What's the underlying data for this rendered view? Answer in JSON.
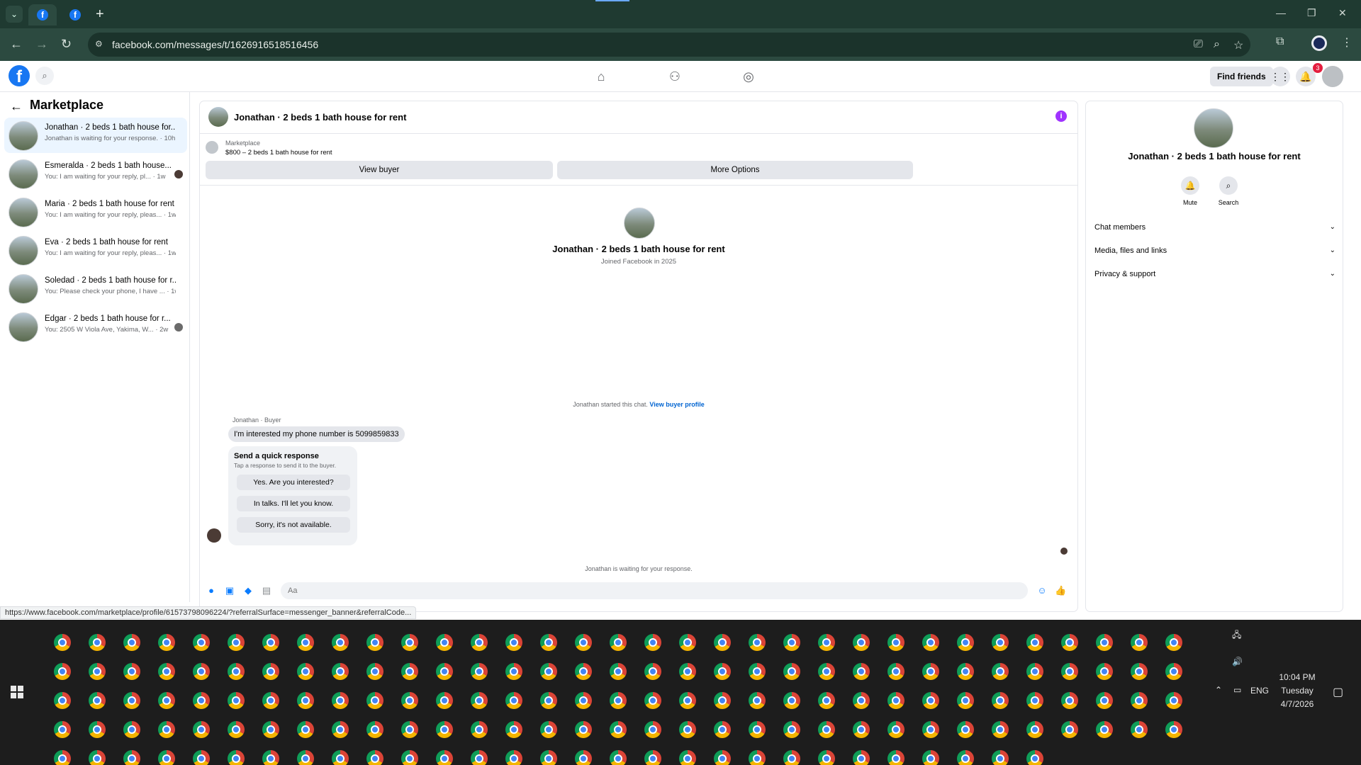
{
  "browser": {
    "url": "facebook.com/messages/t/1626916518516456",
    "status_url": "https://www.facebook.com/marketplace/profile/61573798096224/?referralSurface=messenger_banner&referralCode..."
  },
  "fbnav": {
    "find_friends": "Find friends",
    "notification_count": "3"
  },
  "left_panel": {
    "title": "Marketplace",
    "conversations": [
      {
        "title": "Jonathan · 2 beds 1 bath house for...",
        "subtitle": "Jonathan is waiting for your response. · 10h"
      },
      {
        "title": "Esmeralda · 2 beds 1 bath house...",
        "subtitle": "You: I am waiting for your reply, pl... · 1w"
      },
      {
        "title": "Maria · 2 beds 1 bath house for rent",
        "subtitle": "You: I am waiting for your reply, pleas... · 1w"
      },
      {
        "title": "Eva · 2 beds 1 bath house for rent",
        "subtitle": "You: I am waiting for your reply, pleas... · 1w"
      },
      {
        "title": "Soledad · 2 beds 1 bath house for r...",
        "subtitle": "You: Please check your phone, I have ... · 1w"
      },
      {
        "title": "Edgar · 2 beds 1 bath house for r...",
        "subtitle": "You: 2505 W Viola Ave, Yakima, W... · 2w"
      }
    ]
  },
  "chat": {
    "title": "Jonathan · 2 beds 1 bath house for rent",
    "marketplace_label": "Marketplace",
    "listing": "$800 – 2 beds 1 bath house for rent",
    "view_buyer": "View buyer",
    "more_options": "More Options",
    "center_name": "Jonathan · 2 beds 1 bath house for rent",
    "joined": "Joined Facebook in 2025",
    "started_text": "Jonathan started this chat.",
    "view_buyer_profile": "View buyer profile",
    "sender": "Jonathan · Buyer",
    "message": "I'm interested my phone number is 5099859833",
    "quick_title": "Send a quick response",
    "quick_sub": "Tap a response to send it to the buyer.",
    "quick_replies": [
      "Yes. Are you interested?",
      "In talks. I'll let you know.",
      "Sorry, it's not available."
    ],
    "waiting": "Jonathan is waiting for your response.",
    "composer_placeholder": "Aa"
  },
  "right_panel": {
    "name": "Jonathan · 2 beds 1 bath house for rent",
    "mute": "Mute",
    "search": "Search",
    "rows": [
      "Chat members",
      "Media, files and links",
      "Privacy & support"
    ]
  },
  "tray": {
    "lang": "ENG",
    "time": "10:04 PM",
    "day": "Tuesday",
    "date": "4/7/2026"
  }
}
